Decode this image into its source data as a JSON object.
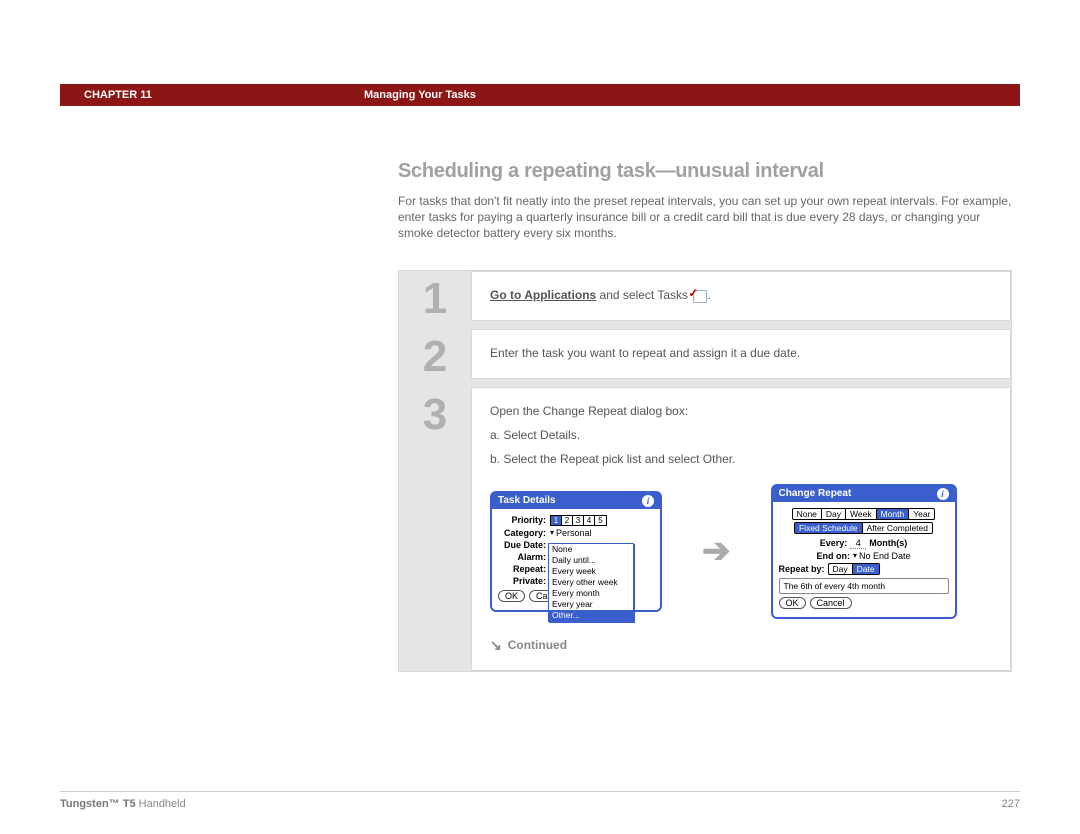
{
  "header": {
    "chapter": "CHAPTER 11",
    "title": "Managing Your Tasks"
  },
  "section": {
    "heading": "Scheduling a repeating task—unusual interval",
    "intro": "For tasks that don't fit neatly into the preset repeat intervals, you can set up your own repeat intervals. For example, enter tasks for paying a quarterly insurance bill or a credit card bill that is due every 28 days, or changing your smoke detector battery every six months."
  },
  "steps": {
    "s1": {
      "num": "1",
      "link": "Go to Applications",
      "text_after": " and select Tasks ",
      "period": "."
    },
    "s2": {
      "num": "2",
      "text": "Enter the task you want to repeat and assign it a due date."
    },
    "s3": {
      "num": "3",
      "text": "Open the Change Repeat dialog box:",
      "a": "a.  Select Details.",
      "b": "b.  Select the Repeat pick list and select Other."
    }
  },
  "task_details": {
    "title": "Task Details",
    "priority_label": "Priority:",
    "priorities": [
      "1",
      "2",
      "3",
      "4",
      "5"
    ],
    "priority_selected": "1",
    "category_label": "Category:",
    "category_value": "Personal",
    "due_label": "Due Date:",
    "alarm_label": "Alarm:",
    "repeat_label": "Repeat:",
    "private_label": "Private:",
    "ok": "OK",
    "cancel": "Can",
    "popup": [
      "None",
      "Daily until...",
      "Every week",
      "Every other week",
      "Every month",
      "Every year",
      "Other..."
    ],
    "popup_selected": "Other..."
  },
  "change_repeat": {
    "title": "Change Repeat",
    "tabs": [
      "None",
      "Day",
      "Week",
      "Month",
      "Year"
    ],
    "tab_selected": "Month",
    "mode": [
      "Fixed Schedule",
      "After Completed"
    ],
    "mode_selected": "Fixed Schedule",
    "every_label": "Every:",
    "every_value": "4",
    "every_unit": "Month(s)",
    "end_label": "End on:",
    "end_value": "No End Date",
    "repeatby_label": "Repeat by:",
    "repeatby": [
      "Day",
      "Date"
    ],
    "repeatby_selected": "Date",
    "summary": "The 6th of every 4th month",
    "ok": "OK",
    "cancel": "Cancel"
  },
  "continued": "Continued",
  "footer": {
    "product_bold": "Tungsten™ T5",
    "product_rest": " Handheld",
    "page": "227"
  }
}
